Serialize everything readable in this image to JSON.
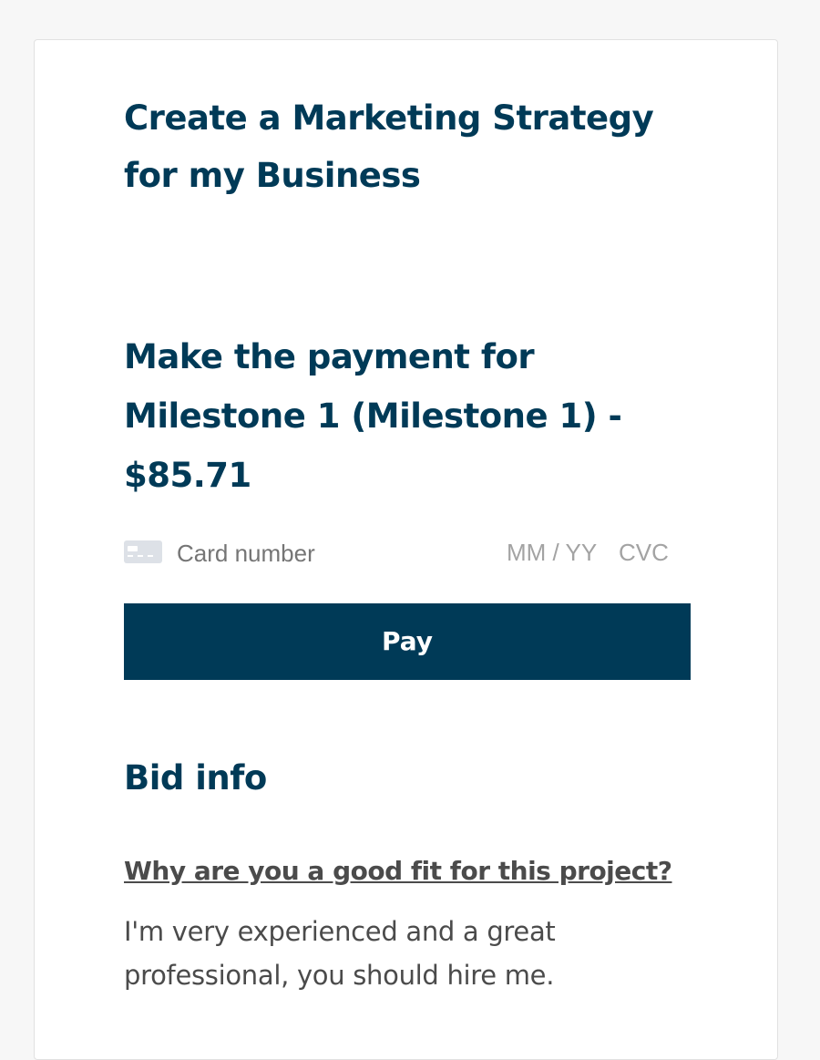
{
  "project": {
    "title": "Create a Marketing Strategy for my Business"
  },
  "payment": {
    "title": "Make the payment for Milestone 1 (Milestone 1) - $85.71",
    "card_icon": "credit-card-icon",
    "card_number_placeholder": "Card number",
    "expiry_placeholder": "MM / YY",
    "cvc_placeholder": "CVC",
    "pay_label": "Pay"
  },
  "bid": {
    "section_title": "Bid info",
    "question": "Why are you a good fit for this project?",
    "answer": "I'm very experienced and a great professional, you should hire me."
  },
  "colors": {
    "brand": "#003a57",
    "body_text": "#4b4b4b",
    "placeholder": "#a3a3a3",
    "card_icon": "#dde1e7"
  }
}
